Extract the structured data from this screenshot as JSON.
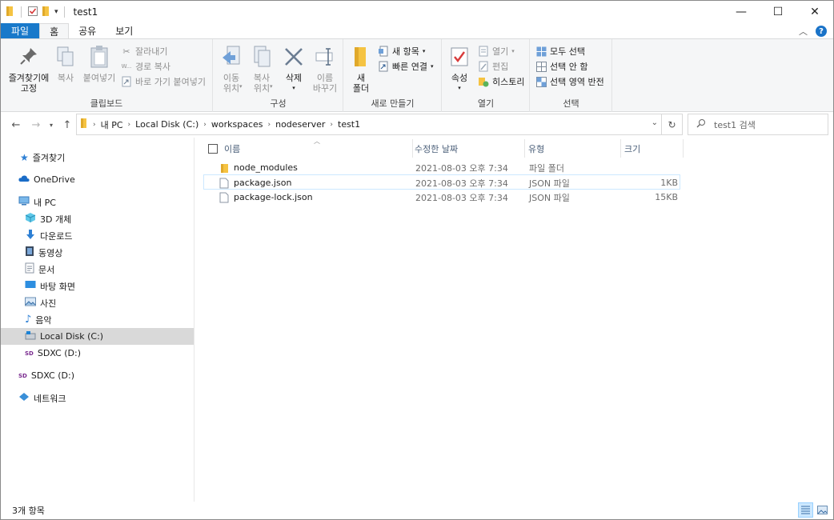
{
  "window": {
    "title": "test1",
    "controls": {
      "minimize": "—",
      "maximize": "☐",
      "close": "✕"
    }
  },
  "ribbon_tabs": [
    "파일",
    "홈",
    "공유",
    "보기"
  ],
  "ribbon": {
    "clipboard": {
      "label": "클립보드",
      "pin_line1": "즐겨찾기에",
      "pin_line2": "고정",
      "copy": "복사",
      "paste": "붙여넣기",
      "cut": "잘라내기",
      "copy_path": "경로 복사",
      "paste_shortcut": "바로 가기 붙여넣기"
    },
    "organize": {
      "label": "구성",
      "move_line1": "이동",
      "move_line2": "위치",
      "copy_line1": "복사",
      "copy_line2": "위치",
      "delete": "삭제",
      "rename_line1": "이름",
      "rename_line2": "바꾸기"
    },
    "new": {
      "label": "새로 만들기",
      "folder_line1": "새",
      "folder_line2": "폴더",
      "new_item": "새 항목",
      "easy_access": "빠른 연결"
    },
    "open": {
      "label": "열기",
      "properties": "속성",
      "open": "열기",
      "edit": "편집",
      "history": "히스토리"
    },
    "select": {
      "label": "선택",
      "select_all": "모두 선택",
      "select_none": "선택 안 함",
      "invert": "선택 영역 반전"
    }
  },
  "address": {
    "crumbs": [
      "내 PC",
      "Local Disk (C:)",
      "workspaces",
      "nodeserver",
      "test1"
    ],
    "search_placeholder": "test1 검색"
  },
  "nav": {
    "quick_access": "즐겨찾기",
    "onedrive": "OneDrive",
    "this_pc": "내 PC",
    "objects3d": "3D 개체",
    "downloads": "다운로드",
    "videos": "동영상",
    "documents": "문서",
    "desktop": "바탕 화면",
    "pictures": "사진",
    "music": "음악",
    "local_disk": "Local Disk (C:)",
    "sdxc_sub": "SDXC (D:)",
    "sdxc": "SDXC (D:)",
    "network": "네트워크"
  },
  "columns": {
    "name": "이름",
    "modified": "수정한 날짜",
    "type": "유형",
    "size": "크기"
  },
  "files": [
    {
      "name": "node_modules",
      "modified": "2021-08-03 오후 7:34",
      "type": "파일 폴더",
      "size": ""
    },
    {
      "name": "package.json",
      "modified": "2021-08-03 오후 7:34",
      "type": "JSON 파일",
      "size": "1KB"
    },
    {
      "name": "package-lock.json",
      "modified": "2021-08-03 오후 7:34",
      "type": "JSON 파일",
      "size": "15KB"
    }
  ],
  "status": {
    "count": "3개 항목"
  },
  "colors": {
    "file_tab": "#1979ca",
    "selected_nav": "#d9d9d9",
    "hover_row": "#cce8ff",
    "folder": "#f5c342"
  }
}
